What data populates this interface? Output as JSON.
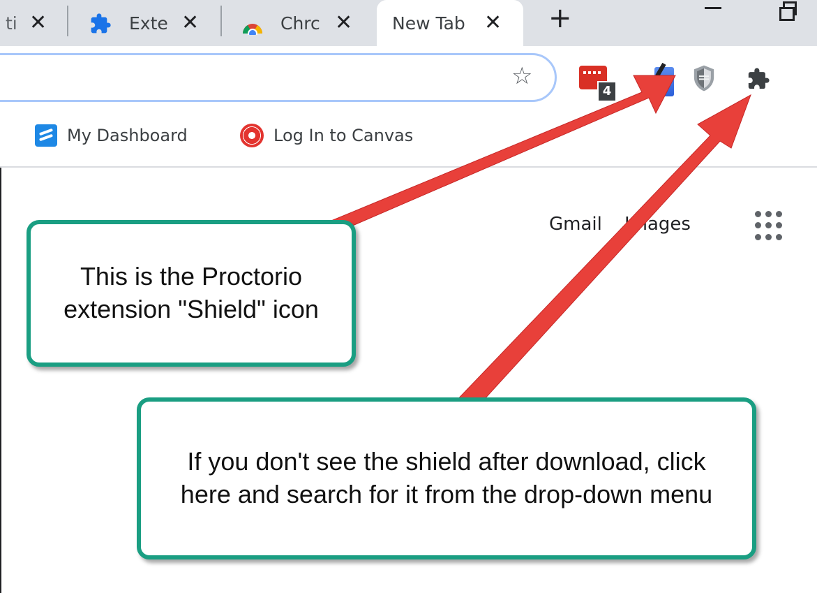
{
  "tabs": [
    {
      "label": "ti",
      "active": false
    },
    {
      "label": "Exte",
      "active": false,
      "icon": "puzzle-icon"
    },
    {
      "label": "Chrc",
      "active": false,
      "icon": "chrome-icon"
    },
    {
      "label": "New Tab",
      "active": true
    }
  ],
  "toolbar": {
    "extension_badge_count": "4",
    "icons": [
      "star-icon",
      "red-extension-icon",
      "blue-extension-icon",
      "shield-icon",
      "puzzle-icon"
    ]
  },
  "bookmarks": [
    {
      "label": "My Dashboard",
      "icon": "dashboard-icon"
    },
    {
      "label": "Log In to Canvas",
      "icon": "canvas-icon"
    }
  ],
  "page": {
    "gmail_label": "Gmail",
    "images_label": "Images"
  },
  "callouts": {
    "shield_text": "This is the Proctorio extension \"Shield\" icon",
    "puzzle_text": "If you don't see the shield after download, click here and search for it from the drop-down menu"
  },
  "colors": {
    "arrow": "#e8403a",
    "callout_border": "#1a9e82",
    "tabstrip": "#dee1e6",
    "omnibox_border": "#a8c7fa"
  }
}
